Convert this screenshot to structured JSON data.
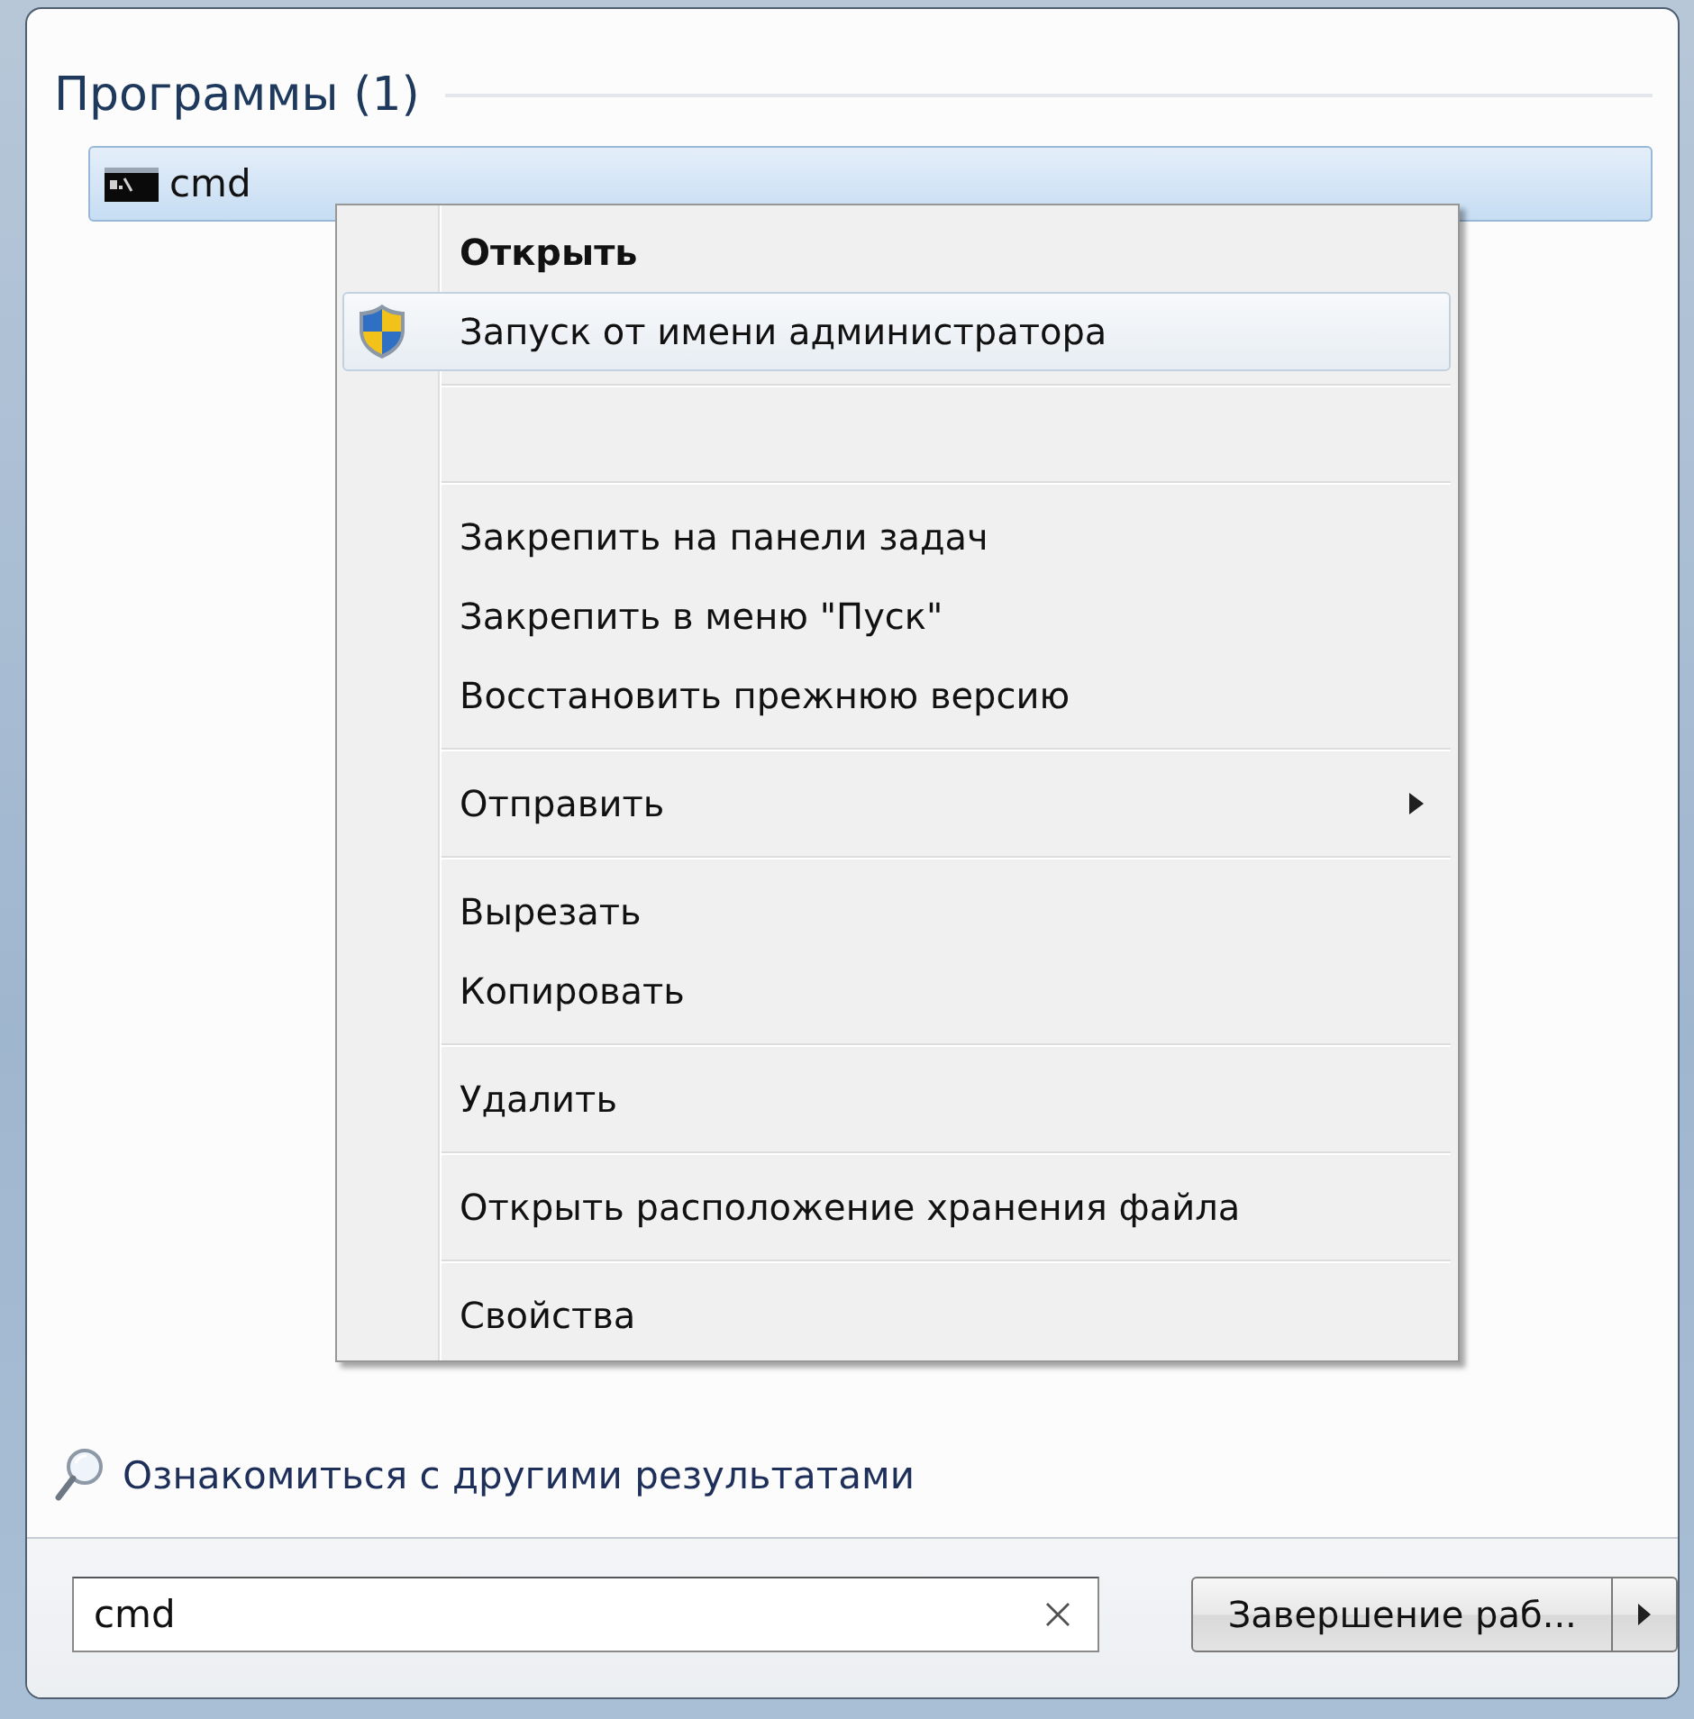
{
  "results": {
    "heading": "Программы (1)",
    "items": [
      {
        "label": "cmd",
        "selected": true
      }
    ]
  },
  "context_menu": {
    "items": [
      {
        "kind": "item",
        "label": "Открыть",
        "default": true,
        "selected": false
      },
      {
        "kind": "elevated_item",
        "label": "Запуск от имени администратора",
        "default": false,
        "selected": true
      },
      {
        "kind": "separator"
      },
      {
        "kind": "spacer"
      },
      {
        "kind": "separator"
      },
      {
        "kind": "item",
        "label": "Закрепить на панели задач",
        "default": false,
        "selected": false
      },
      {
        "kind": "item",
        "label": "Закрепить в меню \"Пуск\"",
        "default": false,
        "selected": false
      },
      {
        "kind": "item",
        "label": "Восстановить прежнюю версию",
        "default": false,
        "selected": false
      },
      {
        "kind": "separator"
      },
      {
        "kind": "submenu",
        "label": "Отправить",
        "default": false,
        "selected": false
      },
      {
        "kind": "separator"
      },
      {
        "kind": "item",
        "label": "Вырезать",
        "default": false,
        "selected": false
      },
      {
        "kind": "item",
        "label": "Копировать",
        "default": false,
        "selected": false
      },
      {
        "kind": "separator"
      },
      {
        "kind": "item",
        "label": "Удалить",
        "default": false,
        "selected": false
      },
      {
        "kind": "separator"
      },
      {
        "kind": "item",
        "label": "Открыть расположение хранения файла",
        "default": false,
        "selected": false
      },
      {
        "kind": "separator"
      },
      {
        "kind": "item",
        "label": "Свойства",
        "default": false,
        "selected": false
      }
    ]
  },
  "more_results_link": "Ознакомиться с другими результатами",
  "search": {
    "value": "cmd"
  },
  "shutdown_button": {
    "label": "Завершение раб..."
  }
}
